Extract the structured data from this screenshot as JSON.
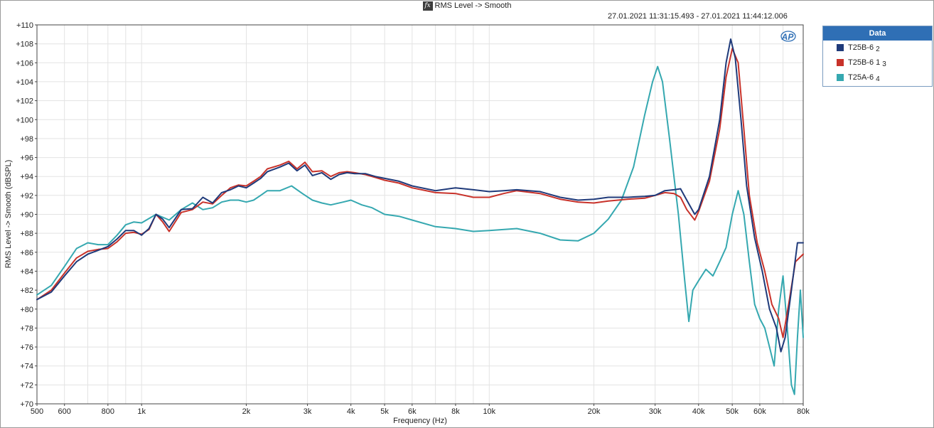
{
  "header": {
    "title": "RMS Level -> Smooth",
    "fx_icon": "fx-icon",
    "timestamp": "27.01.2021 11:31:15.493 - 27.01.2021 11:44:12.006"
  },
  "legend": {
    "title": "Data",
    "items": [
      {
        "label": "T25B-6",
        "sub": "2",
        "color": "#1f3a7a"
      },
      {
        "label": "T25B-6 1",
        "sub": "3",
        "color": "#c8322a"
      },
      {
        "label": "T25A-6",
        "sub": "4",
        "color": "#35a8b0"
      }
    ]
  },
  "logo_text": "AP",
  "chart_data": {
    "type": "line",
    "xlabel": "Frequency (Hz)",
    "ylabel": "RMS Level -> Smooth (dBSPL)",
    "xscale": "log",
    "xlim": [
      500,
      80000
    ],
    "ylim": [
      70,
      110
    ],
    "grid": true,
    "legend_position": "outside-right",
    "xticks": [
      500,
      600,
      800,
      1000,
      2000,
      3000,
      4000,
      5000,
      6000,
      8000,
      10000,
      20000,
      30000,
      40000,
      50000,
      60000,
      80000
    ],
    "xtick_labels": [
      "500",
      "600",
      "800",
      "1k",
      "2k",
      "3k",
      "4k",
      "5k",
      "6k",
      "8k",
      "10k",
      "20k",
      "30k",
      "40k",
      "50k",
      "60k",
      "80k"
    ],
    "yticks": [
      70,
      72,
      74,
      76,
      78,
      80,
      82,
      84,
      86,
      88,
      90,
      92,
      94,
      96,
      98,
      100,
      102,
      104,
      106,
      108,
      110
    ],
    "ytick_labels": [
      "+70",
      "+72",
      "+74",
      "+76",
      "+78",
      "+80",
      "+82",
      "+84",
      "+86",
      "+88",
      "+90",
      "+92",
      "+94",
      "+96",
      "+98",
      "+100",
      "+102",
      "+104",
      "+106",
      "+108",
      "+110"
    ],
    "series": [
      {
        "name": "T25B-6 2",
        "color": "#1f3a7a",
        "points": [
          [
            500,
            81.0
          ],
          [
            550,
            81.8
          ],
          [
            600,
            83.5
          ],
          [
            650,
            85.0
          ],
          [
            700,
            85.8
          ],
          [
            750,
            86.2
          ],
          [
            800,
            86.6
          ],
          [
            850,
            87.4
          ],
          [
            900,
            88.3
          ],
          [
            950,
            88.3
          ],
          [
            1000,
            87.8
          ],
          [
            1050,
            88.5
          ],
          [
            1100,
            90.0
          ],
          [
            1150,
            89.5
          ],
          [
            1200,
            88.6
          ],
          [
            1300,
            90.5
          ],
          [
            1400,
            90.6
          ],
          [
            1500,
            91.8
          ],
          [
            1600,
            91.2
          ],
          [
            1700,
            92.3
          ],
          [
            1800,
            92.6
          ],
          [
            1900,
            93.0
          ],
          [
            2000,
            92.8
          ],
          [
            2100,
            93.3
          ],
          [
            2200,
            93.8
          ],
          [
            2300,
            94.5
          ],
          [
            2500,
            95.0
          ],
          [
            2650,
            95.4
          ],
          [
            2800,
            94.6
          ],
          [
            2950,
            95.2
          ],
          [
            3100,
            94.1
          ],
          [
            3300,
            94.4
          ],
          [
            3500,
            93.7
          ],
          [
            3700,
            94.2
          ],
          [
            3900,
            94.4
          ],
          [
            4100,
            94.3
          ],
          [
            4400,
            94.3
          ],
          [
            4700,
            94.0
          ],
          [
            5000,
            93.8
          ],
          [
            5500,
            93.5
          ],
          [
            6000,
            93.0
          ],
          [
            7000,
            92.5
          ],
          [
            8000,
            92.8
          ],
          [
            9000,
            92.6
          ],
          [
            10000,
            92.4
          ],
          [
            11000,
            92.5
          ],
          [
            12000,
            92.6
          ],
          [
            14000,
            92.4
          ],
          [
            16000,
            91.8
          ],
          [
            18000,
            91.5
          ],
          [
            20000,
            91.6
          ],
          [
            22000,
            91.8
          ],
          [
            25000,
            91.8
          ],
          [
            28000,
            91.9
          ],
          [
            30000,
            92.0
          ],
          [
            32000,
            92.5
          ],
          [
            34000,
            92.6
          ],
          [
            35500,
            92.7
          ],
          [
            37000,
            91.5
          ],
          [
            39000,
            90.0
          ],
          [
            40000,
            90.5
          ],
          [
            43000,
            94.0
          ],
          [
            46000,
            100.0
          ],
          [
            48000,
            106.0
          ],
          [
            49500,
            108.5
          ],
          [
            51000,
            106.5
          ],
          [
            53000,
            100.0
          ],
          [
            55000,
            93.0
          ],
          [
            58000,
            87.5
          ],
          [
            61000,
            84.0
          ],
          [
            64000,
            80.0
          ],
          [
            67000,
            78.0
          ],
          [
            69000,
            75.5
          ],
          [
            71000,
            77.0
          ],
          [
            74000,
            82.0
          ],
          [
            77000,
            87.0
          ],
          [
            80000,
            87.0
          ]
        ]
      },
      {
        "name": "T25B-6 1 3",
        "color": "#c8322a",
        "points": [
          [
            500,
            81.0
          ],
          [
            550,
            82.0
          ],
          [
            600,
            83.8
          ],
          [
            650,
            85.4
          ],
          [
            700,
            86.1
          ],
          [
            750,
            86.3
          ],
          [
            800,
            86.4
          ],
          [
            850,
            87.1
          ],
          [
            900,
            88.0
          ],
          [
            950,
            88.1
          ],
          [
            1000,
            87.9
          ],
          [
            1050,
            88.4
          ],
          [
            1100,
            90.0
          ],
          [
            1150,
            89.2
          ],
          [
            1200,
            88.2
          ],
          [
            1300,
            90.2
          ],
          [
            1400,
            90.5
          ],
          [
            1500,
            91.3
          ],
          [
            1600,
            91.1
          ],
          [
            1700,
            92.0
          ],
          [
            1800,
            92.8
          ],
          [
            1900,
            93.1
          ],
          [
            2000,
            93.0
          ],
          [
            2100,
            93.5
          ],
          [
            2200,
            94.0
          ],
          [
            2300,
            94.8
          ],
          [
            2500,
            95.2
          ],
          [
            2650,
            95.6
          ],
          [
            2800,
            94.8
          ],
          [
            2950,
            95.5
          ],
          [
            3100,
            94.5
          ],
          [
            3300,
            94.6
          ],
          [
            3500,
            94.0
          ],
          [
            3700,
            94.4
          ],
          [
            3900,
            94.5
          ],
          [
            4100,
            94.4
          ],
          [
            4400,
            94.2
          ],
          [
            4700,
            93.9
          ],
          [
            5000,
            93.6
          ],
          [
            5500,
            93.3
          ],
          [
            6000,
            92.8
          ],
          [
            7000,
            92.3
          ],
          [
            8000,
            92.2
          ],
          [
            9000,
            91.8
          ],
          [
            10000,
            91.8
          ],
          [
            11000,
            92.2
          ],
          [
            12000,
            92.5
          ],
          [
            14000,
            92.2
          ],
          [
            16000,
            91.6
          ],
          [
            18000,
            91.3
          ],
          [
            20000,
            91.2
          ],
          [
            22000,
            91.4
          ],
          [
            25000,
            91.6
          ],
          [
            28000,
            91.7
          ],
          [
            30000,
            92.0
          ],
          [
            32000,
            92.3
          ],
          [
            34000,
            92.2
          ],
          [
            35500,
            91.8
          ],
          [
            37000,
            90.5
          ],
          [
            39000,
            89.4
          ],
          [
            40000,
            90.3
          ],
          [
            43000,
            93.5
          ],
          [
            46000,
            99.0
          ],
          [
            48000,
            104.5
          ],
          [
            50000,
            107.5
          ],
          [
            52000,
            106.0
          ],
          [
            54000,
            99.0
          ],
          [
            56000,
            92.0
          ],
          [
            59000,
            87.0
          ],
          [
            62000,
            84.0
          ],
          [
            65000,
            80.5
          ],
          [
            68000,
            79.0
          ],
          [
            70000,
            77.0
          ],
          [
            73000,
            81.0
          ],
          [
            76000,
            85.0
          ],
          [
            80000,
            85.8
          ]
        ]
      },
      {
        "name": "T25A-6 4",
        "color": "#35a8b0",
        "points": [
          [
            500,
            81.5
          ],
          [
            550,
            82.5
          ],
          [
            600,
            84.5
          ],
          [
            650,
            86.4
          ],
          [
            700,
            87.0
          ],
          [
            750,
            86.8
          ],
          [
            800,
            86.8
          ],
          [
            850,
            87.8
          ],
          [
            900,
            88.9
          ],
          [
            950,
            89.2
          ],
          [
            1000,
            89.1
          ],
          [
            1100,
            90.0
          ],
          [
            1200,
            89.4
          ],
          [
            1300,
            90.5
          ],
          [
            1400,
            91.2
          ],
          [
            1500,
            90.5
          ],
          [
            1600,
            90.7
          ],
          [
            1700,
            91.3
          ],
          [
            1800,
            91.5
          ],
          [
            1900,
            91.5
          ],
          [
            2000,
            91.3
          ],
          [
            2100,
            91.5
          ],
          [
            2200,
            92.0
          ],
          [
            2300,
            92.5
          ],
          [
            2500,
            92.5
          ],
          [
            2700,
            93.0
          ],
          [
            2900,
            92.2
          ],
          [
            3100,
            91.5
          ],
          [
            3300,
            91.2
          ],
          [
            3500,
            91.0
          ],
          [
            3800,
            91.3
          ],
          [
            4000,
            91.5
          ],
          [
            4300,
            91.0
          ],
          [
            4600,
            90.7
          ],
          [
            5000,
            90.0
          ],
          [
            5500,
            89.8
          ],
          [
            6000,
            89.4
          ],
          [
            7000,
            88.7
          ],
          [
            8000,
            88.5
          ],
          [
            9000,
            88.2
          ],
          [
            10000,
            88.3
          ],
          [
            12000,
            88.5
          ],
          [
            14000,
            88.0
          ],
          [
            16000,
            87.3
          ],
          [
            18000,
            87.2
          ],
          [
            20000,
            88.0
          ],
          [
            22000,
            89.5
          ],
          [
            24000,
            91.5
          ],
          [
            26000,
            95.0
          ],
          [
            28000,
            100.5
          ],
          [
            29500,
            104.0
          ],
          [
            30500,
            105.6
          ],
          [
            31500,
            104.0
          ],
          [
            33000,
            98.0
          ],
          [
            35000,
            90.0
          ],
          [
            36500,
            83.0
          ],
          [
            37500,
            78.7
          ],
          [
            38500,
            82.0
          ],
          [
            40000,
            83.0
          ],
          [
            42000,
            84.2
          ],
          [
            44000,
            83.5
          ],
          [
            46000,
            85.0
          ],
          [
            48000,
            86.5
          ],
          [
            50000,
            90.0
          ],
          [
            52000,
            92.5
          ],
          [
            54000,
            90.0
          ],
          [
            56000,
            85.0
          ],
          [
            58000,
            80.5
          ],
          [
            60000,
            79.0
          ],
          [
            62000,
            78.0
          ],
          [
            64000,
            76.0
          ],
          [
            66000,
            74.0
          ],
          [
            68000,
            80.0
          ],
          [
            70000,
            83.5
          ],
          [
            72000,
            78.0
          ],
          [
            74000,
            72.0
          ],
          [
            75500,
            71.0
          ],
          [
            77000,
            77.0
          ],
          [
            78500,
            82.0
          ],
          [
            80000,
            77.0
          ]
        ]
      }
    ]
  }
}
